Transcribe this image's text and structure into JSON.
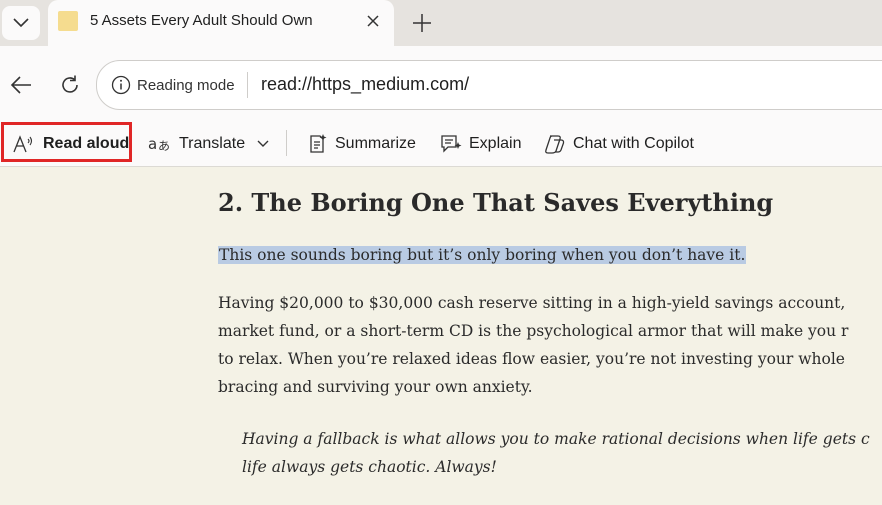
{
  "tab": {
    "title": "5 Assets Every Adult Should Own"
  },
  "address": {
    "site_info_label": "Reading mode",
    "url": "read://https_medium.com/"
  },
  "toolbar": {
    "read_aloud": "Read aloud",
    "translate": "Translate",
    "summarize": "Summarize",
    "explain": "Explain",
    "chat": "Chat with Copilot"
  },
  "article": {
    "heading": "2. The Boring One That Saves Everything",
    "highlighted": "This one sounds boring but it’s only boring when you don’t have it.",
    "paragraph": [
      "Having $20,000 to $30,000 cash reserve sitting in a high-yield savings account,",
      "market fund, or a short-term CD is the psychological armor that will make you r",
      "to relax. When you’re relaxed ideas flow easier, you’re not investing your whole",
      "bracing and surviving your own anxiety."
    ],
    "quote": [
      "Having a fallback is what allows you to make rational decisions when life gets c",
      "life always gets chaotic. Always!"
    ]
  },
  "colors": {
    "page_bg": "#f4f2e6",
    "highlight": "#b9cbe3",
    "outline": "#e02626"
  }
}
